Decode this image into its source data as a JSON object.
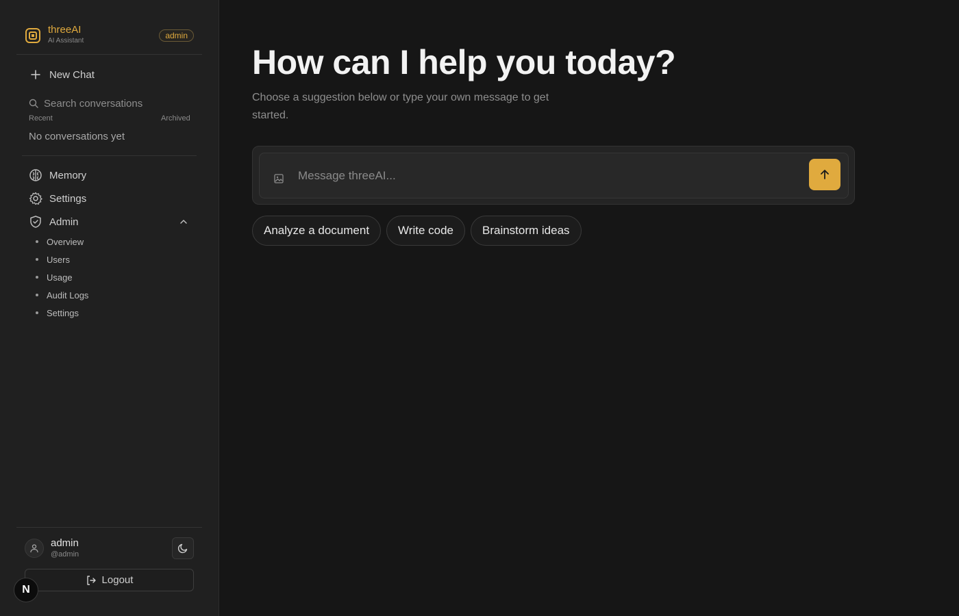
{
  "brand": {
    "title": "threeAI",
    "subtitle": "AI Assistant",
    "role_badge": "admin",
    "accent_color": "#e0aa3e",
    "logo_icon": "square-dot-logo"
  },
  "sidebar": {
    "new_chat_label": "New Chat",
    "search_placeholder": "Search conversations",
    "tabs": {
      "recent": "Recent",
      "archived": "Archived"
    },
    "empty_conversations": "No conversations yet",
    "nav": [
      {
        "label": "Memory",
        "icon": "brain-icon"
      },
      {
        "label": "Settings",
        "icon": "gear-icon"
      },
      {
        "label": "Admin",
        "icon": "shield-check-icon",
        "expanded": true
      }
    ],
    "admin_items": [
      "Overview",
      "Users",
      "Usage",
      "Audit Logs",
      "Settings"
    ]
  },
  "user": {
    "name": "admin",
    "handle": "@admin",
    "logout_label": "Logout",
    "theme_icon": "moon-icon"
  },
  "dev_badge": "N",
  "main": {
    "heading": "How can I help you today?",
    "subheading": "Choose a suggestion below or type your own message to get started.",
    "input_placeholder": "Message threeAI...",
    "suggestions": [
      "Analyze a document",
      "Write code",
      "Brainstorm ideas"
    ]
  }
}
